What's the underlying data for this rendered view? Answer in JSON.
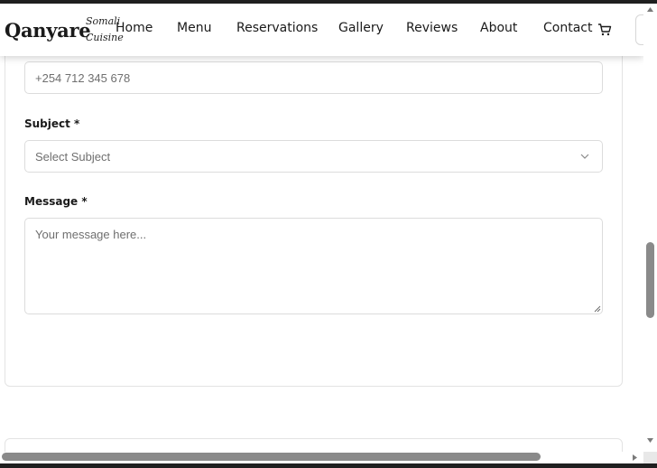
{
  "header": {
    "brand": "Qanyare",
    "tagline": [
      "Somali",
      "Cuisine"
    ],
    "nav": [
      {
        "label": "Home"
      },
      {
        "label": "Menu"
      },
      {
        "label": "Reservations"
      },
      {
        "label": "Gallery"
      },
      {
        "label": "Reviews"
      },
      {
        "label": "About"
      },
      {
        "label": "Contact"
      }
    ],
    "cart_icon": "cart-icon"
  },
  "form": {
    "phone": {
      "placeholder": "+254 712 345 678"
    },
    "subject": {
      "label": "Subject *",
      "selected": "Select Subject"
    },
    "message": {
      "label": "Message *",
      "placeholder": "Your message here..."
    }
  },
  "colors": {
    "text": "#1a1a1a",
    "placeholder": "#6f6f6f",
    "border": "#dcdcdc",
    "scrollbar_thumb": "#8a8a8a"
  }
}
